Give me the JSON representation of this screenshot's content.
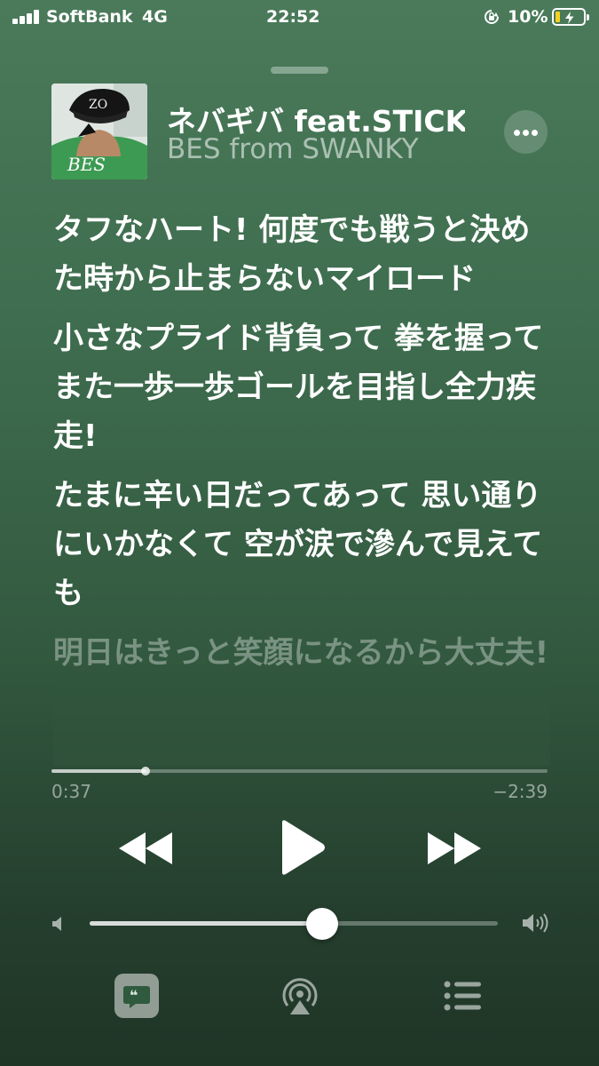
{
  "status": {
    "carrier": "SoftBank",
    "network": "4G",
    "time": "22:52",
    "battery_percent": "10%",
    "battery_level": 0.1,
    "battery_color": "#f5d020",
    "icons": [
      "signal-icon",
      "rotation-lock-icon",
      "battery-charging-icon"
    ]
  },
  "now_playing": {
    "title": "ネバギバ feat.STICKY",
    "artist": "BES from SWANKY"
  },
  "lyrics": [
    {
      "text": "タフなハート! 何度でも戦うと決めた時から止まらないマイロード",
      "active": true
    },
    {
      "text": "小さなプライド背負って 拳を握って また一歩一歩ゴールを目指し全力疾走!",
      "active": true
    },
    {
      "text": "たまに辛い日だってあって 思い通りにいかなくて 空が涙で滲んで見えても",
      "active": true
    },
    {
      "text": "明日はきっと笑顔になるから大丈夫!",
      "active": false
    }
  ],
  "playback": {
    "elapsed": "0:37",
    "remaining": "−2:39",
    "progress": 0.19,
    "volume": 0.57,
    "state": "paused"
  },
  "controls": {
    "icons": [
      "previous-icon",
      "play-icon",
      "next-icon",
      "volume-low-icon",
      "volume-high-icon",
      "lyrics-icon",
      "airplay-icon",
      "queue-icon",
      "more-icon"
    ]
  },
  "album_art": {
    "label": "BES"
  },
  "colors": {
    "background_top": "#4a7a5a",
    "background_bottom": "#1f3526"
  }
}
